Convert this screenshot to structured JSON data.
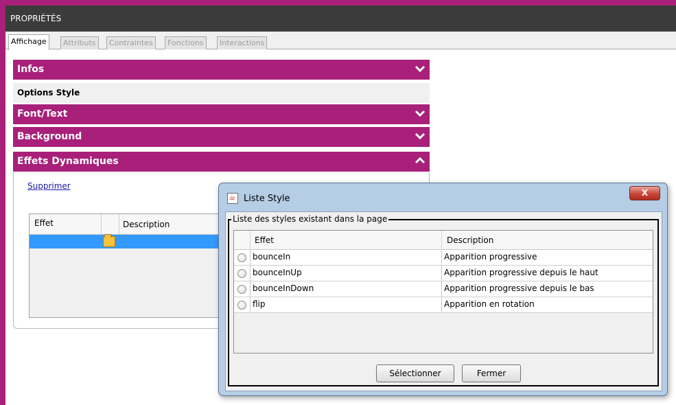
{
  "panel": {
    "title": "PROPRIÉTÉS",
    "tabs": [
      {
        "label": "Affichage"
      },
      {
        "label": "Attributs"
      },
      {
        "label": "Contraintes"
      },
      {
        "label": "Fonctions"
      },
      {
        "label": "Interactions"
      }
    ],
    "sections": {
      "infos": "Infos",
      "options_style": "Options Style",
      "font_text": "Font/Text",
      "background": "Background",
      "effets": "Effets Dynamiques"
    },
    "supprimer_link": "Supprimer",
    "table": {
      "col_effet": "Effet",
      "col_description": "Description"
    }
  },
  "dialog": {
    "title": "Liste Style",
    "close": "X",
    "group_label": "Liste des styles existant dans la page",
    "columns": {
      "effet": "Effet",
      "description": "Description"
    },
    "rows": [
      {
        "effet": "bounceIn",
        "description": "Apparition progressive"
      },
      {
        "effet": "bounceInUp",
        "description": "Apparition progressive depuis le haut"
      },
      {
        "effet": "bounceInDown",
        "description": "Apparition progressive depuis le bas"
      },
      {
        "effet": "flip",
        "description": "Apparition en rotation"
      }
    ],
    "buttons": {
      "select": "Sélectionner",
      "close": "Fermer"
    }
  },
  "colors": {
    "accent": "#a8207a",
    "title_bar": "#3b3b3b",
    "selection": "#3399ff"
  },
  "icons": {
    "section_collapsed": "chevron-down-icon",
    "section_expanded": "chevron-up-icon",
    "row_cell": "folder-icon",
    "window": "java-icon"
  }
}
